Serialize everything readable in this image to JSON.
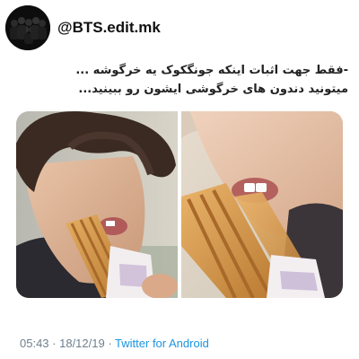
{
  "account": {
    "handle": "@BTS.edit.mk",
    "avatar_icon": "group-photo-avatar"
  },
  "tweet": {
    "lines": [
      "-فقط جهت اثبات اینکه جونگکوک یه خرگوشه ...",
      "میتونید دندون های خرگوشی ایشون رو ببینید..."
    ]
  },
  "media": {
    "photos": [
      {
        "name": "photo-left",
        "icon": "person-eating-churro"
      },
      {
        "name": "photo-right",
        "icon": "closeup-eating-churro"
      }
    ]
  },
  "footer": {
    "time": "05:43",
    "separator1": " · ",
    "date": "18/12/19",
    "separator2": " · ",
    "source": "Twitter for Android"
  },
  "colors": {
    "meta_text": "#6e7f8e",
    "source_link": "#1b95e0",
    "handle_text": "#111111"
  }
}
